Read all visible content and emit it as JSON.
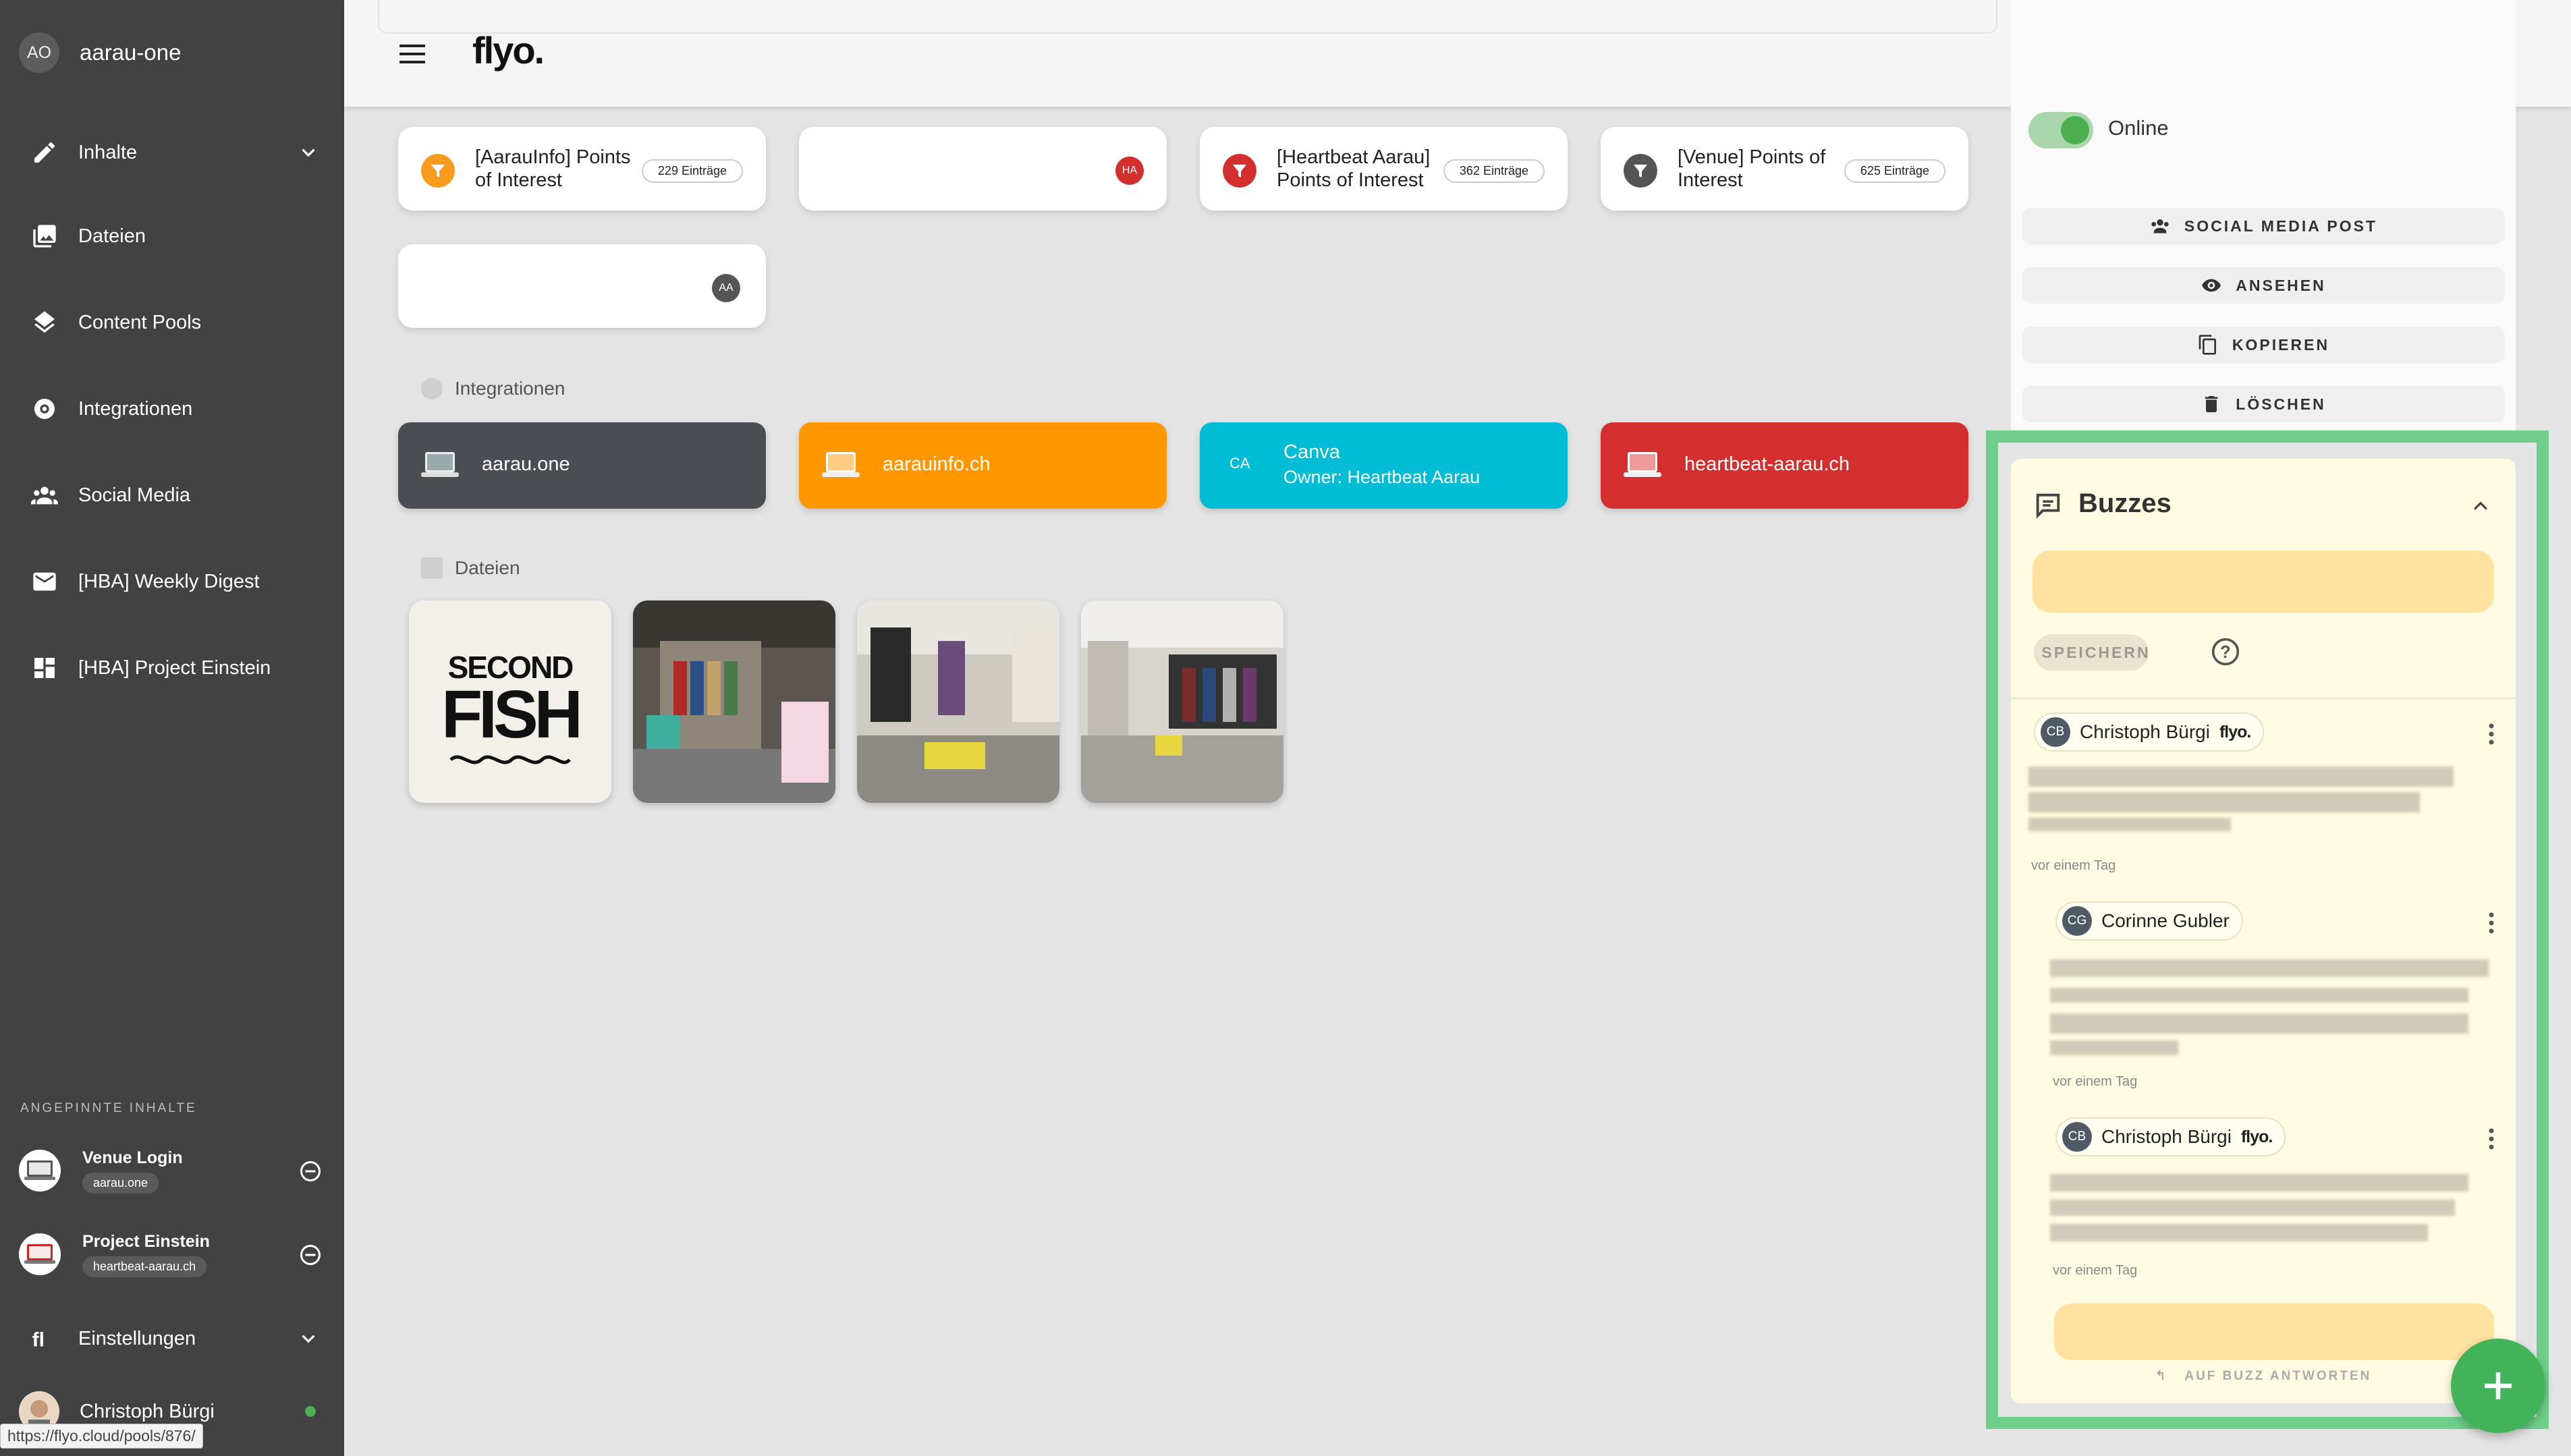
{
  "sidebar": {
    "avatar": "AO",
    "workspace": "aarau-one",
    "nav": [
      "Inhalte",
      "Dateien",
      "Content Pools",
      "Integrationen",
      "Social Media",
      "[HBA] Weekly Digest",
      "[HBA] Project Einstein"
    ],
    "pinned_title": "ANGEPINNTE INHALTE",
    "pinned": [
      {
        "title": "Venue Login",
        "chip": "aarau.one"
      },
      {
        "title": "Project Einstein",
        "chip": "heartbeat-aarau.ch"
      }
    ],
    "settings": "Einstellungen",
    "user": "Christoph Bürgi",
    "status_color": "#4caf50"
  },
  "status_url": "https://flyo.cloud/pools/876/",
  "topbar": {
    "logo": "flyo.",
    "icons": [
      "bell-icon",
      "search-icon",
      "list-icon",
      "people-icon",
      "magic-icon",
      "headset-icon"
    ]
  },
  "pools": [
    {
      "title": "[AarauInfo] Points of Interest",
      "badge": "229 Einträge",
      "color": "#f89b1c"
    },
    {
      "initials": "HA",
      "color": "#d32f2f"
    },
    {
      "title": "[Heartbeat Aarau] Points of Interest",
      "badge": "362 Einträge",
      "color": "#d32f2f"
    },
    {
      "title": "[Venue] Points of Interest",
      "badge": "625 Einträge",
      "color": "#555"
    },
    {
      "initials": "AA",
      "color": "#555"
    }
  ],
  "sections": {
    "integrations": "Integrationen",
    "files": "Dateien"
  },
  "integrations": [
    {
      "label": "aarau.one",
      "color": "#4a4d52"
    },
    {
      "label": "aarauinfo.ch",
      "color": "#ff9800"
    },
    {
      "avatar": "CA",
      "label": "Canva",
      "sub": "Owner: Heartbeat Aarau",
      "color": "#00bcd4"
    },
    {
      "label": "heartbeat-aarau.ch",
      "color": "#d32f2f"
    }
  ],
  "files": {
    "logo_line1": "SECOND",
    "logo_line2": "FISH"
  },
  "panel": {
    "online_label": "Online",
    "actions": [
      "SOCIAL MEDIA POST",
      "ANSEHEN",
      "KOPIEREN",
      "LÖSCHEN"
    ]
  },
  "buzzes": {
    "title": "Buzzes",
    "save": "SPEICHERN",
    "reply": "AUF BUZZ ANTWORTEN",
    "items": [
      {
        "initials": "CB",
        "name": "Christoph Bürgi",
        "flyo": "flyo.",
        "time": "vor einem Tag"
      },
      {
        "initials": "CG",
        "name": "Corinne Gubler",
        "time": "vor einem Tag"
      },
      {
        "initials": "CB",
        "name": "Christoph Bürgi",
        "flyo": "flyo.",
        "time": "vor einem Tag"
      }
    ]
  },
  "colors": {
    "highlight": "#6fcf8a",
    "fab": "#43b35a"
  }
}
